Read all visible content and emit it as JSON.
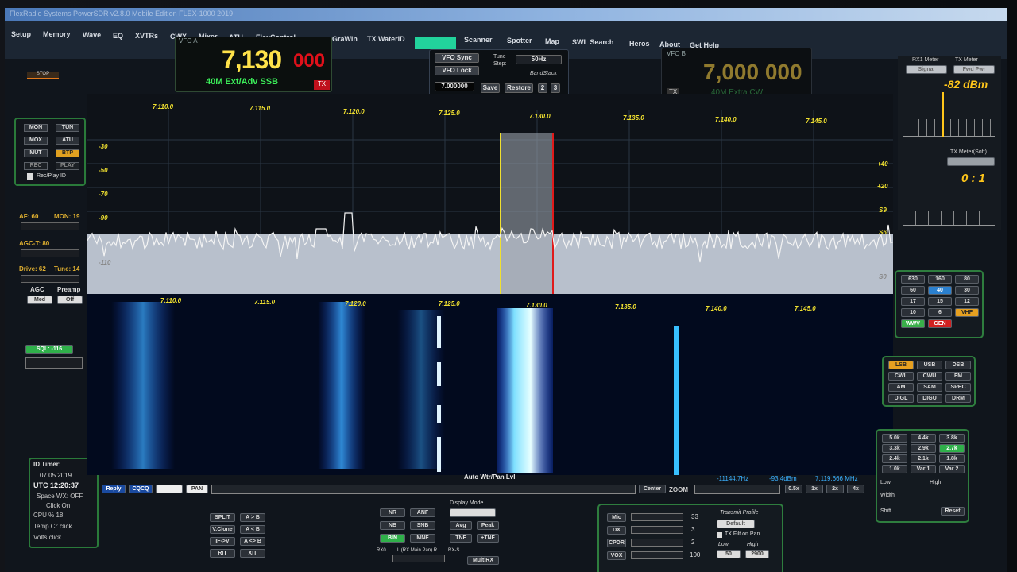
{
  "menu": {
    "items": [
      "Setup",
      "Memory",
      "Wave",
      "EQ",
      "XVTRs",
      "CWX",
      "Mixer",
      "ATU",
      "FlexControl",
      "GraWin",
      "TX WaterID",
      "Scanner",
      "Spotter",
      "Map",
      "SWL Search",
      "Heros",
      "About",
      "Get Help"
    ]
  },
  "vfo_a": {
    "label": "VFO A",
    "freq_main": "7,130",
    "freq_sub": "000",
    "band": "40M Ext/Adv SSB",
    "tx": "TX"
  },
  "vfo_controls": {
    "sync": "VFO Sync",
    "lock": "VFO Lock",
    "tune_step_label": "Tune Step:",
    "tune_step": "50Hz",
    "bandstack": "BandStack",
    "freq_entry": "7.000000",
    "save": "Save",
    "restore": "Restore",
    "n2": "2",
    "n3": "3"
  },
  "vfo_b": {
    "label": "VFO B",
    "freq": "7,000 000",
    "band": "40M Extra CW",
    "tx": "TX"
  },
  "meters": {
    "rx1": "RX1 Meter",
    "tx": "TX Meter",
    "rx_mode": "Signal",
    "tx_mode": "Fwd Pwr",
    "dbm": "-82 dBm",
    "swr_label": "TX Meter(Soft)",
    "swr": "0 : 1"
  },
  "left": {
    "stop": "STOP",
    "mon": "MON",
    "tun": "TUN",
    "mox": "MOX",
    "atu": "ATU",
    "mut": "MUT",
    "btp": "BTP",
    "rec": "REC",
    "play": "PLAY",
    "recplay": "Rec/Play ID",
    "af": "AF: 60",
    "mon_v": "MON: 19",
    "agct": "AGC-T: 80",
    "drive": "Drive: 62",
    "tune": "Tune: 14",
    "agc": "AGC",
    "preamp": "Preamp",
    "agc_v": "Med",
    "preamp_v": "Off",
    "sql": "SQL: -116"
  },
  "idtimer": {
    "title": "ID Timer:",
    "date": "07.05.2019",
    "utc": "UTC  12:20:37",
    "space": "Space WX: OFF",
    "clickon": "Click On",
    "cpu": "CPU %   18",
    "temp": "Temp C°  click",
    "volts": "Volts   click"
  },
  "spectrum": {
    "freqs": [
      "7.110.0",
      "7.115.0",
      "7.120.0",
      "7.125.0",
      "7.130.0",
      "7.135.0",
      "7.140.0",
      "7.145.0"
    ],
    "ylabels": [
      "-30",
      "-50",
      "-70",
      "-90",
      "-110"
    ],
    "rlabels": [
      "+40",
      "+20",
      "S9",
      "S6",
      "S0"
    ]
  },
  "bottombar": {
    "reply": "Reply",
    "cqcq": "CQCQ",
    "pan": "PAN",
    "autowf": "Auto Wtr/Pan Lvl",
    "center": "Center",
    "zoom": "ZOOM",
    "cursor_freq": "-11144.7Hz",
    "cursor_dbm": "-93.4dBm",
    "cursor_mhz": "7.119.666 MHz",
    "z05": "0.5x",
    "z1": "1x",
    "z2": "2x",
    "z4": "4x"
  },
  "bands": [
    "630",
    "160",
    "80",
    "60",
    "40",
    "30",
    "17",
    "15",
    "12",
    "10",
    "6",
    "VHF",
    "WWV",
    "GEN"
  ],
  "modes": [
    "LSB",
    "USB",
    "DSB",
    "CWL",
    "CWU",
    "FM",
    "AM",
    "SAM",
    "SPEC",
    "DIGL",
    "DIGU",
    "DRM"
  ],
  "filters": [
    "5.0k",
    "4.4k",
    "3.8k",
    "3.3k",
    "2.9k",
    "2.7k",
    "2.4k",
    "2.1k",
    "1.8k",
    "1.0k",
    "Var 1",
    "Var 2"
  ],
  "filter_ctl": {
    "low": "Low",
    "high": "High",
    "width": "Width",
    "shift": "Shift",
    "reset": "Reset"
  },
  "splits": [
    "SPLIT",
    "A > B",
    "V.Clone",
    "A < B",
    "IF->V",
    "A <> B",
    "RIT",
    "XIT"
  ],
  "display": {
    "title": "Display Mode",
    "nr": "NR",
    "anf": "ANF",
    "nb": "NB",
    "snb": "SNB",
    "bin": "BIN",
    "mnf": "MNF",
    "avg": "Avg",
    "peak": "Peak",
    "ctun": "CTUN",
    "tnf": "TNF",
    "ptnf": "+TNF",
    "rx0": "RX0",
    "lr": "L (RX Main Pan) R",
    "rxs": "RX-S",
    "mute": "MultiRX"
  },
  "tx": {
    "mic": "Mic",
    "mic_v": "33",
    "dx": "DX",
    "dx_v": "3",
    "cpdr": "CPDR",
    "cpdr_v": "2",
    "vox": "VOX",
    "vox_v": "100",
    "profile": "Transmit Profile",
    "profile_v": "Default",
    "fit": "TX Filt on Pan",
    "low": "Low",
    "high": "High",
    "low_v": "50",
    "high_v": "2900"
  }
}
